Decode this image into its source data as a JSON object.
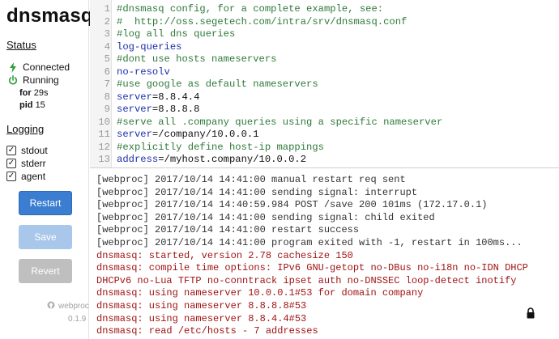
{
  "app": {
    "title": "dnsmasq"
  },
  "status": {
    "heading": "Status",
    "connected_label": "Connected",
    "running_label": "Running",
    "for_key": "for",
    "for_value": "29s",
    "pid_key": "pid",
    "pid_value": "15",
    "connected_color": "#2e9e3a",
    "running_color": "#2e9e3a"
  },
  "logging": {
    "heading": "Logging",
    "options": [
      {
        "label": "stdout",
        "checked": true
      },
      {
        "label": "stderr",
        "checked": true
      },
      {
        "label": "agent",
        "checked": true
      }
    ]
  },
  "buttons": {
    "restart": "Restart",
    "save": "Save",
    "revert": "Revert"
  },
  "footer": {
    "brand": "webproc",
    "version": "0.1.9"
  },
  "editor": {
    "lines": [
      {
        "n": "1",
        "text": "#dnsmasq config, for a complete example, see:",
        "kind": "comment"
      },
      {
        "n": "2",
        "text": "#  http://oss.segetech.com/intra/srv/dnsmasq.conf",
        "kind": "comment"
      },
      {
        "n": "3",
        "text": "#log all dns queries",
        "kind": "comment"
      },
      {
        "n": "4",
        "key": "log-queries",
        "kind": "kv"
      },
      {
        "n": "5",
        "text": "#dont use hosts nameservers",
        "kind": "comment"
      },
      {
        "n": "6",
        "key": "no-resolv",
        "kind": "kv"
      },
      {
        "n": "7",
        "text": "#use google as default nameservers",
        "kind": "comment"
      },
      {
        "n": "8",
        "key": "server",
        "value": "=8.8.4.4",
        "kind": "kv"
      },
      {
        "n": "9",
        "key": "server",
        "value": "=8.8.8.8",
        "kind": "kv"
      },
      {
        "n": "10",
        "text": "#serve all .company queries using a specific nameserver",
        "kind": "comment"
      },
      {
        "n": "11",
        "key": "server",
        "value": "=/company/10.0.0.1",
        "kind": "kv"
      },
      {
        "n": "12",
        "text": "#explicitly define host-ip mappings",
        "kind": "comment"
      },
      {
        "n": "13",
        "key": "address",
        "value": "=/myhost.company/10.0.0.2",
        "kind": "kv"
      }
    ]
  },
  "logs": [
    {
      "text": "[webproc] 2017/10/14 14:41:00 manual restart req sent",
      "kind": "web"
    },
    {
      "text": "[webproc] 2017/10/14 14:41:00 sending signal: interrupt",
      "kind": "web"
    },
    {
      "text": "[webproc] 2017/10/14 14:40:59.984 POST /save 200 101ms (172.17.0.1)",
      "kind": "web"
    },
    {
      "text": "[webproc] 2017/10/14 14:41:00 sending signal: child exited",
      "kind": "web"
    },
    {
      "text": "[webproc] 2017/10/14 14:41:00 restart success",
      "kind": "web"
    },
    {
      "text": "[webproc] 2017/10/14 14:41:00 program exited with -1, restart in 100ms...",
      "kind": "web"
    },
    {
      "text": "dnsmasq: started, version 2.78 cachesize 150",
      "kind": "dns"
    },
    {
      "text": "dnsmasq: compile time options: IPv6 GNU-getopt no-DBus no-i18n no-IDN DHCP",
      "kind": "dns"
    },
    {
      "text": "DHCPv6 no-Lua TFTP no-conntrack ipset auth no-DNSSEC loop-detect inotify",
      "kind": "dns"
    },
    {
      "text": "dnsmasq: using nameserver 10.0.0.1#53 for domain company",
      "kind": "dns"
    },
    {
      "text": "dnsmasq: using nameserver 8.8.8.8#53",
      "kind": "dns"
    },
    {
      "text": "dnsmasq: using nameserver 8.8.4.4#53",
      "kind": "dns"
    },
    {
      "text": "dnsmasq: read /etc/hosts - 7 addresses",
      "kind": "dns"
    }
  ],
  "icons": {
    "lock": "lock-icon",
    "brand": "github-icon"
  }
}
